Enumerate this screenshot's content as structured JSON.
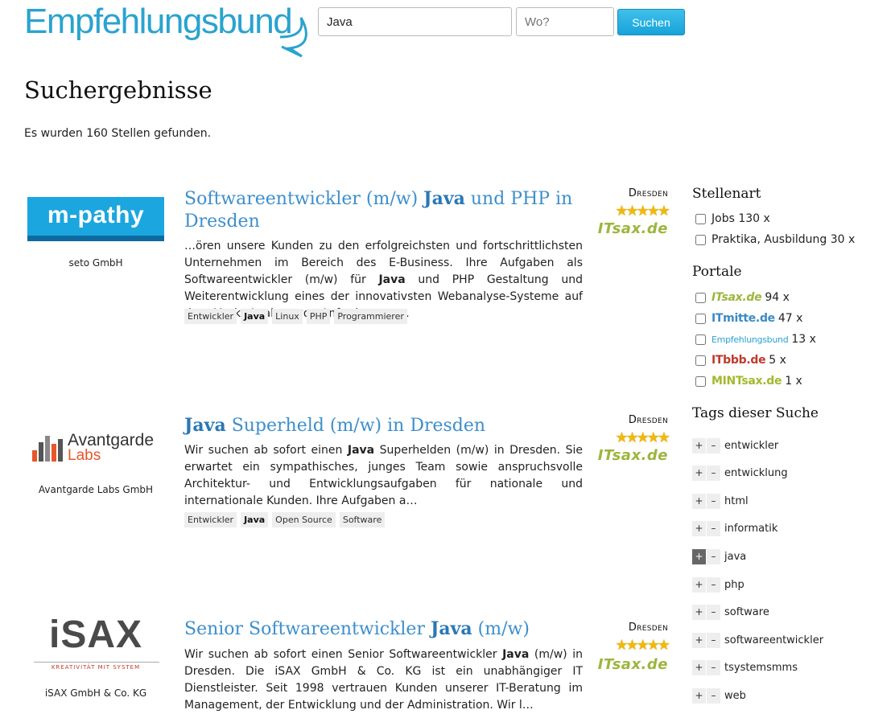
{
  "header": {
    "logo_text": "Empfehlungsbund",
    "search_value": "Java",
    "location_placeholder": "Wo?",
    "search_button": "Suchen"
  },
  "page_title": "Suchergebnisse",
  "result_count": "Es wurden 160 Stellen gefunden.",
  "results": [
    {
      "company_logo_text": "m-pathy",
      "company": "seto GmbH",
      "title_parts": [
        "Softwareentwickler (m/w) ",
        "Java",
        " und PHP in Dresden"
      ],
      "city": "Dresden",
      "rating": 5,
      "stars": "★★★★★",
      "portal": "ITsax.de",
      "snippet_parts": [
        "…ören unsere Kunden zu den erfolgreichsten und fortschrittlichsten Unternehmen im Bereich des E-Business. Ihre Aufgaben als Softwareentwickler (m/w) für ",
        "Java",
        " und PHP Gestaltung und Weiterentwicklung eines der innovativsten Webanalyse-Systeme auf dem Markt Analyse von Anforderunge…"
      ],
      "tags": [
        "Entwickler",
        "Java",
        "Linux",
        "PHP",
        "Programmierer"
      ]
    },
    {
      "company_logo_text": "Avantgarde",
      "company_logo_sub": "Labs",
      "company": "Avantgarde Labs GmbH",
      "title_parts": [
        "",
        "Java",
        " Superheld (m/w) in Dresden"
      ],
      "city": "Dresden",
      "rating": 5,
      "stars": "★★★★★",
      "portal": "ITsax.de",
      "snippet_parts": [
        "Wir suchen ab sofort einen ",
        "Java",
        " Superhelden (m/w) in Dresden. Sie erwartet ein sympathisches, junges Team sowie anspruchsvolle Architektur- und Entwicklungsaufgaben für nationale und internationale Kunden. Ihre Aufgaben a…"
      ],
      "tags": [
        "Entwickler",
        "Java",
        "Open Source",
        "Software"
      ]
    },
    {
      "company_logo_text": "iSAX",
      "company_logo_sub": "KREATIVITÄT MIT SYSTEM",
      "company": "iSAX GmbH & Co. KG",
      "title_parts": [
        "Senior Softwareentwickler ",
        "Java",
        " (m/w)"
      ],
      "city": "Dresden",
      "rating": 5,
      "stars": "★★★★★",
      "portal": "ITsax.de",
      "snippet_parts": [
        "Wir suchen ab sofort einen Senior Softwareentwickler ",
        "Java",
        " (m/w) in Dresden. Die iSAX GmbH & Co. KG ist ein unabhängiger IT Dienstleister. Seit 1998 vertrauen Kunden unserer IT-Beratung im Management, der Entwicklung und der Administration. Wir l…"
      ],
      "tags": []
    }
  ],
  "sidebar": {
    "stellenart_heading": "Stellenart",
    "stellenart": [
      {
        "label": "Jobs 130 x"
      },
      {
        "label": "Praktika, Ausbildung 30 x"
      }
    ],
    "portale_heading": "Portale",
    "portale": [
      {
        "name": "ITsax.de",
        "count": "94 x",
        "color": "#9cb63d"
      },
      {
        "name": "ITmitte.de",
        "count": "47 x",
        "color": "#3a8ac4"
      },
      {
        "name": "Empfehlungsbund",
        "count": "13 x",
        "color": "#2aa3cf"
      },
      {
        "name": "ITbbb.de",
        "count": "5 x",
        "color": "#c0392b"
      },
      {
        "name": "MINTsax.de",
        "count": "1 x",
        "color": "#a4b82c"
      }
    ],
    "tags_heading": "Tags dieser Suche",
    "tags": [
      {
        "name": "entwickler",
        "active": false
      },
      {
        "name": "entwicklung",
        "active": false
      },
      {
        "name": "html",
        "active": false
      },
      {
        "name": "informatik",
        "active": false
      },
      {
        "name": "java",
        "active": true
      },
      {
        "name": "php",
        "active": false
      },
      {
        "name": "software",
        "active": false
      },
      {
        "name": "softwareentwickler",
        "active": false
      },
      {
        "name": "tsystemsmms",
        "active": false
      },
      {
        "name": "web",
        "active": false
      }
    ],
    "plus": "+",
    "minus": "–"
  },
  "colors": {
    "brand": "#2aa3cf",
    "link": "#3d8fcc",
    "button": "#17a3da",
    "star": "#f2b90c"
  }
}
